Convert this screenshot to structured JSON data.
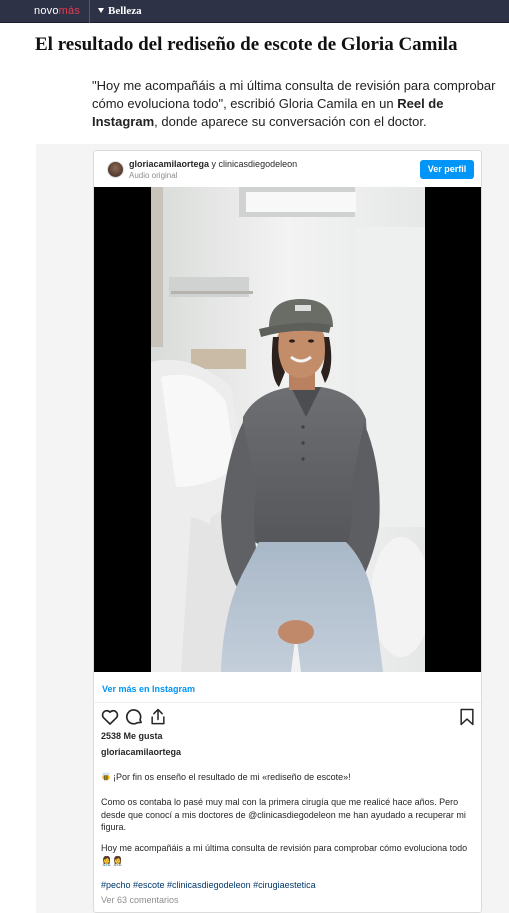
{
  "site": {
    "logo_part1": "novo",
    "logo_part2": "más",
    "section": "Belleza"
  },
  "article": {
    "headline": "El resultado del rediseño de escote de Gloria Camila",
    "intro_part1": "\"Hoy me acompañáis a mi última consulta de revisión para comprobar cómo evoluciona todo\", escribió Gloria Camila en un ",
    "intro_bold": "Reel de Instagram",
    "intro_part2": ", donde aparece su conversación con el doctor."
  },
  "embed": {
    "user1": "gloriacamilaortega",
    "and": " y ",
    "user2": "clinicasdiegodeleon",
    "audio": "Audio original",
    "ver_perfil": "Ver perfil",
    "ver_mas": "Ver más en Instagram",
    "likes": "2538 Me gusta",
    "username": "gloriacamilaortega",
    "caption_line1": "¡Por fin os enseño el resultado de mi «rediseño de escote»!",
    "caption_para2": "Como os contaba lo pasé muy mal con la primera cirugía que me realicé hace años. Pero desde que conocí a mis doctores de @clinicasdiegodeleon me han ayudado a recuperar mi figura.",
    "caption_para3": "Hoy me acompañáis a mi última consulta de revisión para comprobar cómo evoluciona todo 👩‍⚕️👩‍⚕️",
    "hashtags": "#pecho #escote #clinicasdiegodeleon #cirugiaestetica",
    "comments": "Ver 63 comentarios"
  },
  "icons": [
    "caret-down-icon",
    "heart-icon",
    "comment-icon",
    "share-icon",
    "bookmark-icon",
    "bee-icon"
  ],
  "colors": {
    "topbar": "#2e3247",
    "logo_accent": "#e8394f",
    "instagram_blue": "#0095f6",
    "hashtag": "#00376b"
  }
}
